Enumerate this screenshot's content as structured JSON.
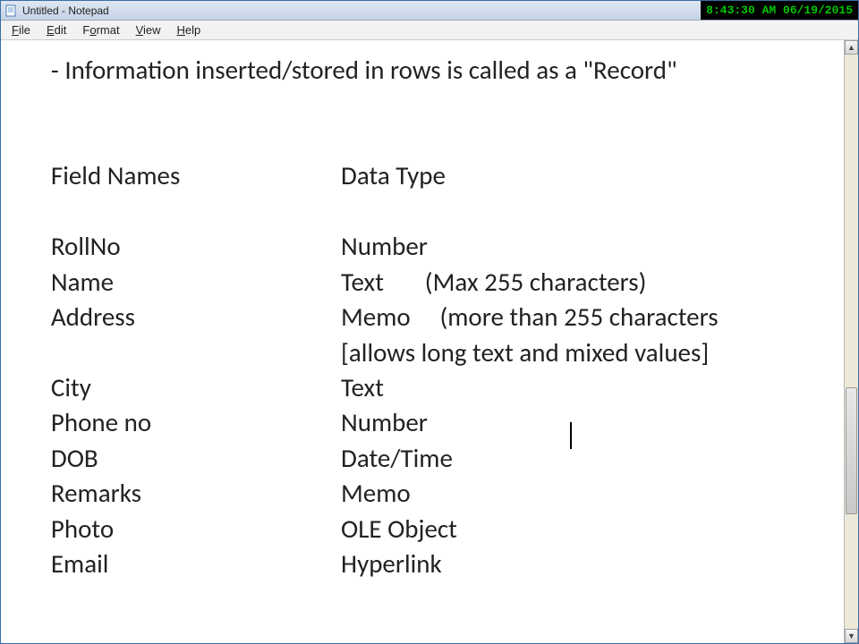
{
  "titlebar": {
    "title": "Untitled - Notepad",
    "clock": "8:43:30 AM 06/19/2015"
  },
  "menu": {
    "file": "File",
    "edit": "Edit",
    "format": "Format",
    "view": "View",
    "help": "Help"
  },
  "content": {
    "line1": "       - Information inserted/stored in rows is called as a \"Record\"",
    "blank": "",
    "hdr_field": "       Field Names",
    "hdr_type": "Data Type",
    "rows": [
      {
        "field": "       RollNo",
        "type": "Number"
      },
      {
        "field": "       Name",
        "type": "Text       (Max 255 characters)"
      },
      {
        "field": "       Address",
        "type": "Memo     (more than 255 characters"
      },
      {
        "field": "",
        "type": "[allows long text and mixed values]"
      },
      {
        "field": "       City",
        "type": "Text"
      },
      {
        "field": "       Phone no",
        "type": "Number"
      },
      {
        "field": "       DOB",
        "type": "Date/Time"
      },
      {
        "field": "       Remarks",
        "type": "Memo"
      },
      {
        "field": "       Photo",
        "type": "OLE Object"
      },
      {
        "field": "       Email",
        "type": "Hyperlink"
      }
    ]
  }
}
